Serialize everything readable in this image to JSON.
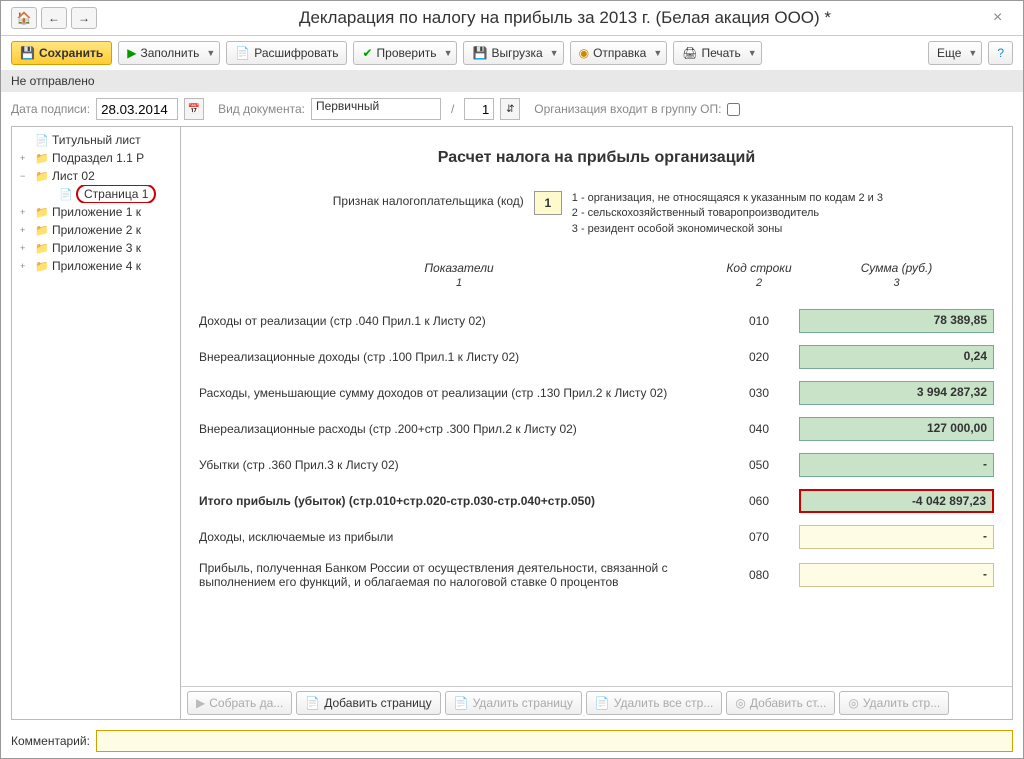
{
  "titlebar": {
    "title": "Декларация по налогу на прибыль за 2013 г. (Белая акация ООО) *"
  },
  "toolbar": {
    "save": "Сохранить",
    "fill": "Заполнить",
    "decode": "Расшифровать",
    "check": "Проверить",
    "upload": "Выгрузка",
    "send": "Отправка",
    "print": "Печать",
    "more": "Еще"
  },
  "status": {
    "text": "Не отправлено"
  },
  "formbar": {
    "date_label": "Дата подписи:",
    "date_value": "28.03.2014",
    "doctype_label": "Вид документа:",
    "doctype_value": "Первичный",
    "page_value": "1",
    "org_label": "Организация входит в группу ОП:"
  },
  "tree": {
    "items": [
      {
        "label": "Титульный лист",
        "type": "doc",
        "exp": ""
      },
      {
        "label": "Подраздел 1.1 Р",
        "type": "folder",
        "exp": "+"
      },
      {
        "label": "Лист 02",
        "type": "folder",
        "exp": "−"
      },
      {
        "label": "Страница 1",
        "type": "doc",
        "exp": "",
        "indent": true,
        "highlighted": true
      },
      {
        "label": "Приложение 1 к",
        "type": "folder",
        "exp": "+"
      },
      {
        "label": "Приложение 2 к",
        "type": "folder",
        "exp": "+"
      },
      {
        "label": "Приложение 3 к",
        "type": "folder",
        "exp": "+"
      },
      {
        "label": "Приложение 4 к",
        "type": "folder",
        "exp": "+"
      }
    ]
  },
  "doc": {
    "title": "Расчет налога на прибыль организаций",
    "taxpayer_label": "Признак налогоплательщика (код)",
    "taxpayer_code": "1",
    "legend1": "1 - организация, не относящаяся к указанным по кодам 2 и 3",
    "legend2": "2 - сельскохозяйственный товаропроизводитель",
    "legend3": "3 - резидент особой экономической зоны",
    "headers": {
      "c1": "Показатели",
      "c2": "Код строки",
      "c3": "Сумма (руб.)"
    },
    "nums": {
      "c1": "1",
      "c2": "2",
      "c3": "3"
    },
    "rows": [
      {
        "label": "Доходы от реализации (стр .040 Прил.1 к Листу 02)",
        "code": "010",
        "val": "78 389,85",
        "style": "green"
      },
      {
        "label": "Внереализационные доходы (стр .100 Прил.1 к Листу 02)",
        "code": "020",
        "val": "0,24",
        "style": "green"
      },
      {
        "label": "Расходы, уменьшающие сумму доходов от реализации (стр .130 Прил.2 к Листу 02)",
        "code": "030",
        "val": "3 994 287,32",
        "style": "green"
      },
      {
        "label": "Внереализационные расходы (стр .200+стр .300 Прил.2 к Листу 02)",
        "code": "040",
        "val": "127 000,00",
        "style": "green"
      },
      {
        "label": "Убытки (стр .360 Прил.3 к Листу 02)",
        "code": "050",
        "val": "-",
        "style": "green"
      },
      {
        "label": "Итого прибыль (убыток)        (стр.010+стр.020-стр.030-стр.040+стр.050)",
        "code": "060",
        "val": "-4 042 897,23",
        "style": "red",
        "bold": true
      },
      {
        "label": "Доходы, исключаемые из прибыли",
        "code": "070",
        "val": "-",
        "style": "yellow"
      },
      {
        "label": "Прибыль, полученная Банком России от осуществления деятельности, связанной с выполнением его функций, и облагаемая по налоговой ставке 0 процентов",
        "code": "080",
        "val": "-",
        "style": "yellow"
      }
    ]
  },
  "bottom": {
    "collect": "Собрать да...",
    "add_page": "Добавить страницу",
    "del_page": "Удалить страницу",
    "del_all": "Удалить все стр...",
    "add_str": "Добавить ст...",
    "del_str": "Удалить стр..."
  },
  "comment": {
    "label": "Комментарий:"
  }
}
